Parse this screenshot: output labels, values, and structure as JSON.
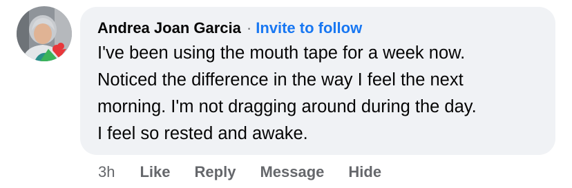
{
  "comment": {
    "author": "Andrea Joan Garcia",
    "separator": "·",
    "follow_label": "Invite to follow",
    "text_lines": [
      "I've been using the mouth tape for a week now.",
      "Noticed the difference in the way I feel the next",
      "morning.  I'm not dragging around during the day.",
      "I feel so rested and awake."
    ],
    "timestamp": "3h",
    "actions": {
      "like": "Like",
      "reply": "Reply",
      "message": "Message",
      "hide": "Hide"
    }
  },
  "colors": {
    "bubble_bg": "#f0f2f5",
    "text_primary": "#050505",
    "text_secondary": "#65676b",
    "link_blue": "#1877f2"
  },
  "icons": {
    "avatar": "user-profile-photo"
  }
}
